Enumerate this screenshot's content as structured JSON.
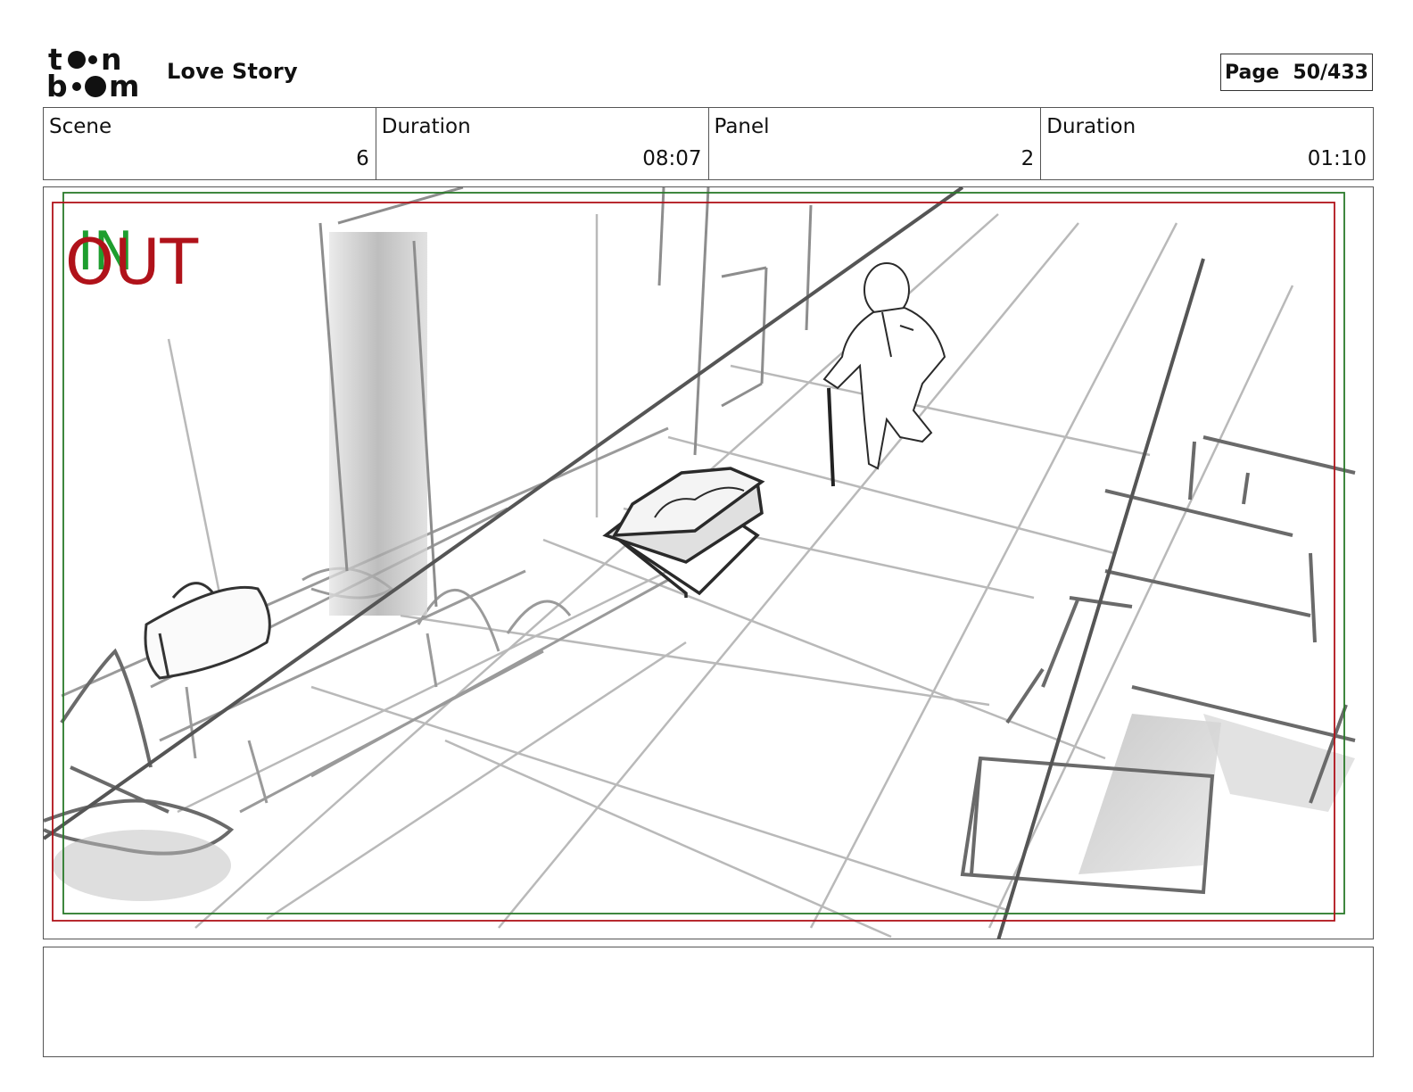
{
  "header": {
    "logo_text": "toon boom",
    "project_title": "Love Story",
    "page_label": "Page",
    "page_number": "50/433"
  },
  "info": {
    "scene_label": "Scene",
    "scene_value": "6",
    "scene_duration_label": "Duration",
    "scene_duration_value": "08:07",
    "panel_label": "Panel",
    "panel_value": "2",
    "panel_duration_label": "Duration",
    "panel_duration_value": "01:10"
  },
  "panel": {
    "in_marker": "IN",
    "out_marker": "OUT",
    "in_color": "#1e9e2e",
    "out_color": "#b0121a",
    "safe_frame_color": "#2a7a2a",
    "camera_frame_color": "#b0121a"
  },
  "notes": {
    "text": ""
  }
}
